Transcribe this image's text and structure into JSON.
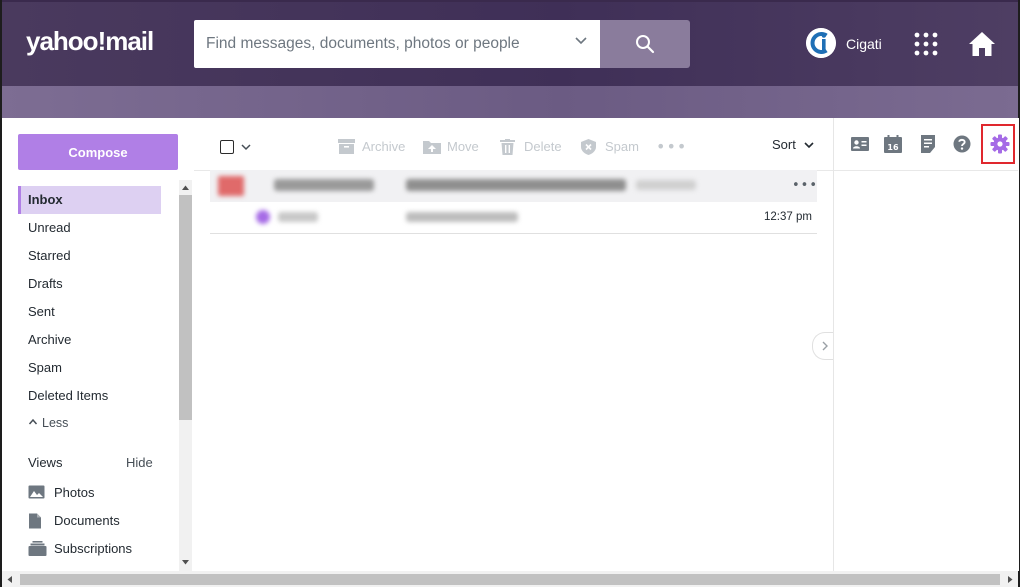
{
  "header": {
    "logo_text": "yahoo!mail",
    "search_placeholder": "Find messages, documents, photos or people",
    "username": "Cigati",
    "accent": "#b07fe6"
  },
  "sidebar": {
    "compose_label": "Compose",
    "items": [
      {
        "label": "Inbox",
        "active": true
      },
      {
        "label": "Unread"
      },
      {
        "label": "Starred"
      },
      {
        "label": "Drafts"
      },
      {
        "label": "Sent"
      },
      {
        "label": "Archive"
      },
      {
        "label": "Spam"
      },
      {
        "label": "Deleted Items"
      }
    ],
    "less_label": "Less",
    "views_label": "Views",
    "hide_label": "Hide",
    "views": [
      {
        "label": "Photos",
        "icon": "photos-icon"
      },
      {
        "label": "Documents",
        "icon": "documents-icon"
      },
      {
        "label": "Subscriptions",
        "icon": "subscriptions-icon"
      }
    ]
  },
  "toolbar": {
    "archive_label": "Archive",
    "move_label": "Move",
    "delete_label": "Delete",
    "spam_label": "Spam",
    "sort_label": "Sort"
  },
  "messages": [
    {
      "time": ""
    },
    {
      "time": "12:37 pm"
    }
  ],
  "right_toolbar": {
    "icons": [
      "contacts-icon",
      "calendar-icon",
      "notepad-icon",
      "help-icon",
      "settings-icon"
    ],
    "calendar_day": "16",
    "highlight_color": "#e0282e"
  }
}
